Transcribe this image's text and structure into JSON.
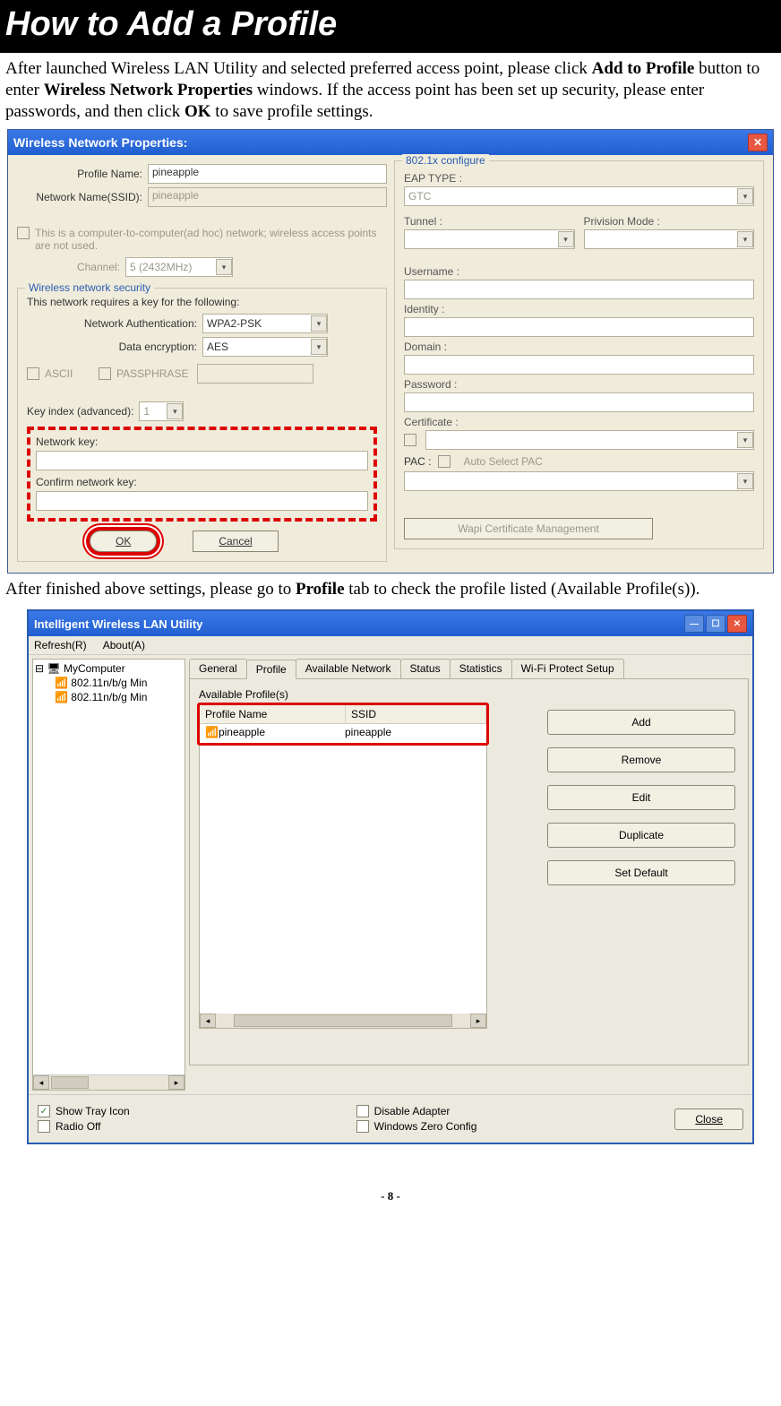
{
  "title": "How to Add a Profile",
  "para1_a": "After launched Wireless LAN Utility and selected preferred access point, please click ",
  "para1_b": "Add to Profile",
  "para1_c": " button to enter ",
  "para1_d": "Wireless Network Properties",
  "para1_e": " windows. If the access point has been set up security, please enter passwords, and then click ",
  "para1_f": "OK",
  "para1_g": " to save profile settings.",
  "dlg1": {
    "title": "Wireless Network Properties:",
    "profile_name_lbl": "Profile Name:",
    "profile_name_val": "pineapple",
    "ssid_lbl": "Network Name(SSID):",
    "ssid_val": "pineapple",
    "adhoc_text": "This is a computer-to-computer(ad hoc) network; wireless access points are not used.",
    "channel_lbl": "Channel:",
    "channel_val": "5  (2432MHz)",
    "security_legend": "Wireless network security",
    "security_text": "This network requires a key for the following:",
    "auth_lbl": "Network Authentication:",
    "auth_val": "WPA2-PSK",
    "enc_lbl": "Data encryption:",
    "enc_val": "AES",
    "ascii": "ASCII",
    "passphrase": "PASSPHRASE",
    "keyidx_lbl": "Key index (advanced):",
    "keyidx_val": "1",
    "netkey_lbl": "Network key:",
    "confirm_lbl": "Confirm network key:",
    "ok": "OK",
    "cancel": "Cancel",
    "cfg_legend": "802.1x configure",
    "eap_lbl": "EAP TYPE :",
    "eap_val": "GTC",
    "tunnel_lbl": "Tunnel :",
    "priv_lbl": "Privision Mode :",
    "user_lbl": "Username :",
    "identity_lbl": "Identity :",
    "domain_lbl": "Domain :",
    "password_lbl": "Password :",
    "cert_lbl": "Certificate :",
    "pac_lbl": "PAC :",
    "autopac": "Auto Select PAC",
    "wapi": "Wapi Certificate Management"
  },
  "para2_a": "After finished above settings, please go to ",
  "para2_b": "Profile",
  "para2_c": " tab to check the profile listed (Available Profile(s)).",
  "dlg2": {
    "title": "Intelligent Wireless LAN Utility",
    "menu_refresh": "Refresh(R)",
    "menu_about": "About(A)",
    "tree_root": "MyComputer",
    "tree_child1": "802.11n/b/g Min",
    "tree_child2": "802.11n/b/g Min",
    "tabs": [
      "General",
      "Profile",
      "Available Network",
      "Status",
      "Statistics",
      "Wi-Fi Protect Setup"
    ],
    "active_tab": 1,
    "avail_legend": "Available Profile(s)",
    "col_profile": "Profile Name",
    "col_ssid": "SSID",
    "row_profile": "pineapple",
    "row_ssid": "pineapple",
    "btn_add": "Add",
    "btn_remove": "Remove",
    "btn_edit": "Edit",
    "btn_dup": "Duplicate",
    "btn_setdef": "Set Default",
    "show_tray": "Show Tray Icon",
    "radio_off": "Radio Off",
    "disable_adapter": "Disable Adapter",
    "win_zero": "Windows Zero Config",
    "close": "Close"
  },
  "pagenum": "- 8 -"
}
